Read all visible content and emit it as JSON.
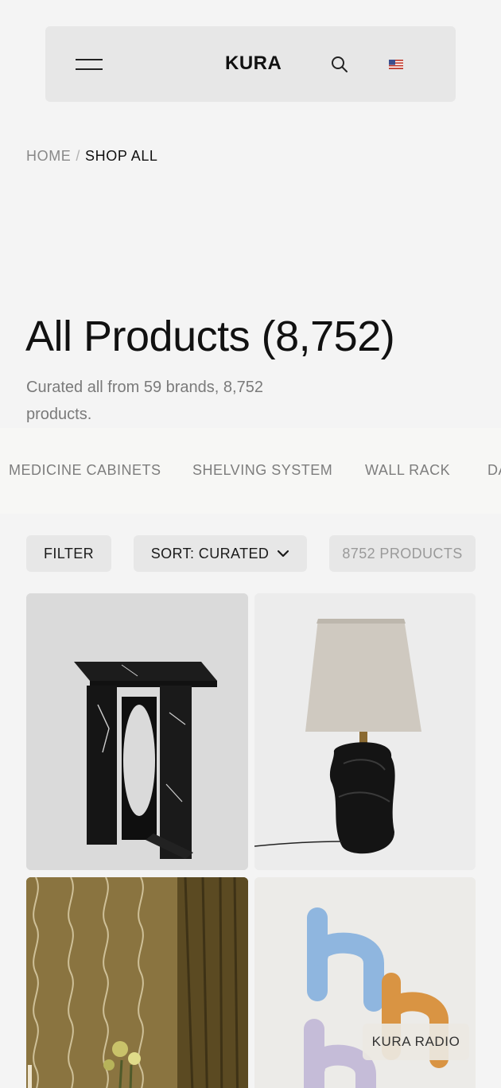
{
  "header": {
    "logo": "KURA",
    "menu_icon": "hamburger-icon",
    "search_icon": "search-icon",
    "locale_icon": "us-flag-icon"
  },
  "breadcrumb": {
    "home": "HOME",
    "separator": "/",
    "current": "SHOP ALL"
  },
  "page": {
    "title": "All Products (8,752)",
    "subtitle": "Curated all from 59 brands, 8,752 products."
  },
  "categories": [
    "MEDICINE CABINETS",
    "SHELVING SYSTEM",
    "WALL RACK",
    "DA"
  ],
  "controls": {
    "filter_label": "FILTER",
    "sort_label": "SORT: CURATED",
    "count_label": "8752 PRODUCTS"
  },
  "products": [
    {
      "image": "black-marble-side-table"
    },
    {
      "image": "ceramic-table-lamp-linen-shade"
    },
    {
      "image": "patterned-wallpaper-room"
    },
    {
      "image": "ceramic-letter-h-wall-hooks"
    }
  ],
  "floating": {
    "radio_label": "KURA RADIO"
  },
  "colors": {
    "background": "#f4f4f4",
    "header_bg": "#e7e7e7",
    "text": "#111111",
    "muted": "#7a7a7a"
  }
}
